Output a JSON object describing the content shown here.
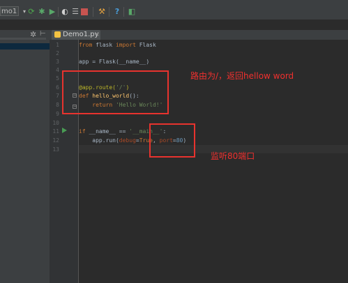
{
  "toolbar": {
    "run_config": "mo1"
  },
  "editor": {
    "tab_label": "Demo1.py",
    "line_numbers": [
      "1",
      "2",
      "3",
      "4",
      "5",
      "6",
      "7",
      "8",
      "9",
      "10",
      "11",
      "12",
      "13"
    ],
    "code": {
      "l1_from": "from",
      "l1_module": " flask ",
      "l1_import": "import",
      "l1_name": " Flask",
      "l3_text": "app = Flask(__name__)",
      "l6_decorator": "@app.route(",
      "l6_arg": "'/'",
      "l6_close": ")",
      "l7_def": "def",
      "l7_fn": " hello_world",
      "l7_rest": "():",
      "l8_indent": "    ",
      "l8_return": "return",
      "l8_str": " 'Hello World!'",
      "l11_if": "if",
      "l11_mid": " __name__ == ",
      "l11_str": "'__main__'",
      "l11_colon": ":",
      "l12_pre": "    app.run(",
      "l12_debug": "debug",
      "l12_eq1": "=",
      "l12_true": "True",
      "l12_comma": ", ",
      "l12_port": "port",
      "l12_eq2": "=",
      "l12_80": "80",
      "l12_close": ")"
    }
  },
  "annotations": {
    "route_note": "路由为/，返回hellow word",
    "port_note": "监听80端口"
  },
  "colors": {
    "annotation": "#e8332e",
    "editor_bg": "#2b2b2b",
    "keyword": "#cc7832",
    "string": "#6a8759",
    "decorator": "#bbb529",
    "number": "#6897bb"
  }
}
